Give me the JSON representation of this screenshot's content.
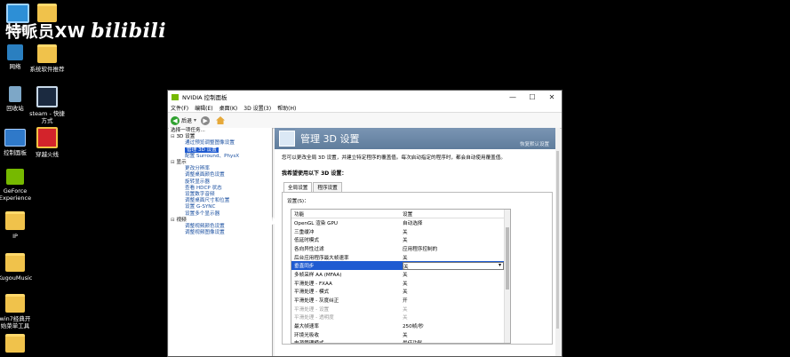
{
  "watermark": {
    "text": "特哌员XW",
    "brand": "bilibili"
  },
  "desktop_icons": [
    {
      "label": "此电脑",
      "icon": "computer-icon"
    },
    {
      "label": "",
      "icon": "folder-icon"
    },
    {
      "label": "网络",
      "icon": "network-icon"
    },
    {
      "label": "系统软件推荐",
      "icon": "folder-icon"
    },
    {
      "label": "回收站",
      "icon": "recycle-bin-icon"
    },
    {
      "label": "steam - 快捷\n方式",
      "icon": "steam-icon"
    },
    {
      "label": "控制面板",
      "icon": "control-panel-icon"
    },
    {
      "label": "穿越火线",
      "icon": "game-icon"
    },
    {
      "label": "GeForce\nExperience",
      "icon": "nvidia-icon"
    },
    {
      "label": "IP",
      "icon": "folder-icon"
    },
    {
      "label": "KugouMusic",
      "icon": "folder-icon"
    },
    {
      "label": "win7经典开\n始菜单工具",
      "icon": "folder-icon"
    },
    {
      "label": "",
      "icon": "folder-icon"
    }
  ],
  "window": {
    "title": "NVIDIA 控制面板",
    "menu": [
      "文件(F)",
      "编辑(E)",
      "桌面(K)",
      "3D 设置(3)",
      "帮助(H)"
    ],
    "toolbar": {
      "back": "后退"
    },
    "tree": {
      "header": "选择一项任务...",
      "rows": [
        {
          "type": "cat",
          "text": "3D 设置"
        },
        {
          "type": "item",
          "text": "通过预览调整图像设置"
        },
        {
          "type": "item",
          "text": "管理 3D 设置",
          "selected": true
        },
        {
          "type": "item",
          "text": "配置 Surround、PhysX"
        },
        {
          "type": "cat",
          "text": "显示"
        },
        {
          "type": "item",
          "text": "更改分辨率"
        },
        {
          "type": "item",
          "text": "调整桌面颜色设置"
        },
        {
          "type": "item",
          "text": "旋转显示器"
        },
        {
          "type": "item",
          "text": "查看 HDCP 状态"
        },
        {
          "type": "item",
          "text": "设置数字音频"
        },
        {
          "type": "item",
          "text": "调整桌面尺寸和位置"
        },
        {
          "type": "item",
          "text": "设置 G-SYNC"
        },
        {
          "type": "item",
          "text": "设置多个显示器"
        },
        {
          "type": "cat",
          "text": "视频"
        },
        {
          "type": "item",
          "text": "调整视频颜色设置"
        },
        {
          "type": "item",
          "text": "调整视频图像设置"
        }
      ]
    },
    "content": {
      "title": "管理 3D 设置",
      "restore": "恢复默认设置",
      "description": "您可以更改全局 3D 设置，并建立特定程序的覆盖值。每次启动指定的程序时，都会自动使用覆盖值。",
      "section": "我希望使用以下 3D 设置：",
      "tabs": [
        "全局设置",
        "程序设置"
      ],
      "settings_label": "设置(S)：",
      "columns": [
        "功能",
        "设置"
      ],
      "rows": [
        {
          "feature": "OpenGL 渲染 GPU",
          "value": "自动选择"
        },
        {
          "feature": "三重缓冲",
          "value": "关"
        },
        {
          "feature": "低延时模式",
          "value": "关"
        },
        {
          "feature": "各向异性过滤",
          "value": "应用程序控制的"
        },
        {
          "feature": "后台应用程序最大帧速率",
          "value": "关"
        },
        {
          "feature": "垂直同步",
          "value": "关",
          "selected": true
        },
        {
          "feature": "多帧采样 AA (MFAA)",
          "value": "关"
        },
        {
          "feature": "平滑处理 - FXAA",
          "value": "关"
        },
        {
          "feature": "平滑处理 - 模式",
          "value": "关"
        },
        {
          "feature": "平滑处理 - 灰度纠正",
          "value": "开"
        },
        {
          "feature": "平滑处理 - 设置",
          "value": "关",
          "disabled": true
        },
        {
          "feature": "平滑处理 - 透明度",
          "value": "关",
          "disabled": true
        },
        {
          "feature": "最大帧速率",
          "value": "250帧/秒"
        },
        {
          "feature": "环境光吸收",
          "value": "关"
        },
        {
          "feature": "电源管理模式",
          "value": "最佳功耗"
        }
      ]
    }
  }
}
